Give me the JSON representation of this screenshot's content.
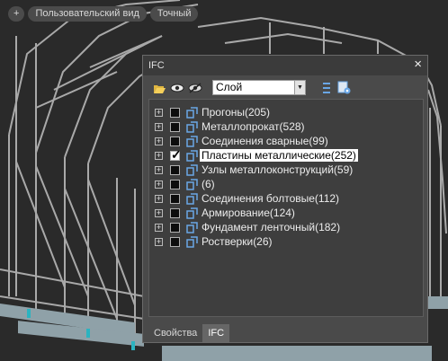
{
  "topbar": {
    "plus": "+",
    "view_label": "Пользовательский вид",
    "mode_label": "Точный"
  },
  "panel": {
    "title": "IFC",
    "close_glyph": "×",
    "toolbar": {
      "layer_value": "Слой"
    },
    "tree": [
      {
        "label": "Прогоны(205)",
        "checked": false,
        "selected": false
      },
      {
        "label": "Металлопрокат(528)",
        "checked": false,
        "selected": false
      },
      {
        "label": "Соединения сварные(99)",
        "checked": false,
        "selected": false
      },
      {
        "label": "Пластины металлические(252)",
        "checked": true,
        "selected": true
      },
      {
        "label": "Узлы металлоконструкций(59)",
        "checked": false,
        "selected": false
      },
      {
        "label": "(6)",
        "checked": false,
        "selected": false
      },
      {
        "label": "Соединения болтовые(112)",
        "checked": false,
        "selected": false
      },
      {
        "label": "Армирование(124)",
        "checked": false,
        "selected": false
      },
      {
        "label": "Фундамент ленточный(182)",
        "checked": false,
        "selected": false
      },
      {
        "label": "Ростверки(26)",
        "checked": false,
        "selected": false
      }
    ],
    "tabs": [
      {
        "label": "Свойства",
        "active": false
      },
      {
        "label": "IFC",
        "active": true
      }
    ]
  },
  "colors": {
    "background": "#2a2a2a",
    "panel": "#4a4a4a",
    "tree_bg": "#3e3e3e",
    "selection": "#ffffff",
    "node_icon": "#6aa7e6",
    "foundation": "#8fa1a8",
    "connector": "#2bb3c0"
  },
  "icons": {
    "open_folder": "folder-open-icon",
    "show": "eye-show-icon",
    "hide": "eye-hide-icon",
    "collapse": "collapse-list-icon",
    "settings": "settings-icon",
    "node": "ifc-node-icon"
  }
}
